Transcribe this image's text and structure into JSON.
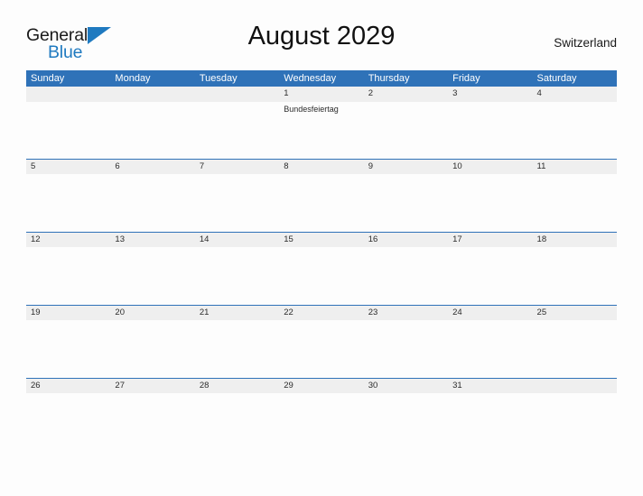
{
  "logo": {
    "primary_text": "General",
    "secondary_text": "Blue",
    "icon": "triangle-flag-icon",
    "primary_color": "#1a1a1a",
    "secondary_color": "#1f7ac0"
  },
  "header": {
    "title": "August 2029",
    "country": "Switzerland"
  },
  "colors": {
    "header_blue": "#2f72b8",
    "date_band_gray": "#efefef",
    "page_background": "#fdfdfd",
    "text": "#2b2b2b"
  },
  "calendar": {
    "weekdays": [
      "Sunday",
      "Monday",
      "Tuesday",
      "Wednesday",
      "Thursday",
      "Friday",
      "Saturday"
    ],
    "weeks": [
      {
        "dates": [
          "",
          "",
          "",
          "1",
          "2",
          "3",
          "4"
        ],
        "events": [
          "",
          "",
          "",
          "Bundesfeiertag",
          "",
          "",
          ""
        ]
      },
      {
        "dates": [
          "5",
          "6",
          "7",
          "8",
          "9",
          "10",
          "11"
        ],
        "events": [
          "",
          "",
          "",
          "",
          "",
          "",
          ""
        ]
      },
      {
        "dates": [
          "12",
          "13",
          "14",
          "15",
          "16",
          "17",
          "18"
        ],
        "events": [
          "",
          "",
          "",
          "",
          "",
          "",
          ""
        ]
      },
      {
        "dates": [
          "19",
          "20",
          "21",
          "22",
          "23",
          "24",
          "25"
        ],
        "events": [
          "",
          "",
          "",
          "",
          "",
          "",
          ""
        ]
      },
      {
        "dates": [
          "26",
          "27",
          "28",
          "29",
          "30",
          "31",
          ""
        ],
        "events": [
          "",
          "",
          "",
          "",
          "",
          "",
          ""
        ]
      }
    ]
  }
}
